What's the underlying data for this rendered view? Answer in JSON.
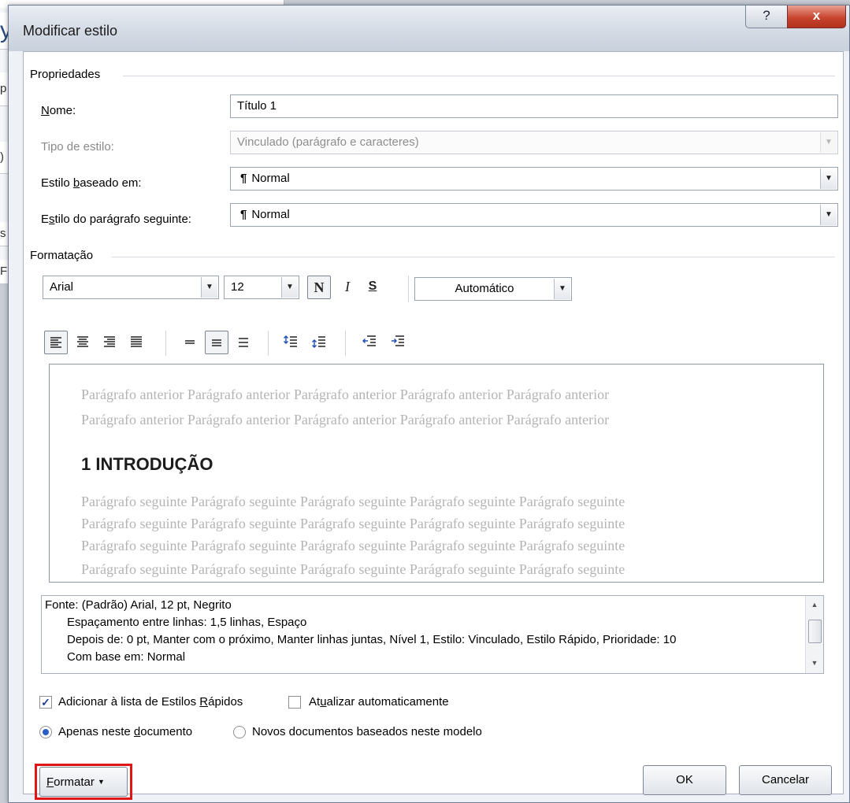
{
  "background": {
    "strip_chars": [
      "y",
      "p",
      ")",
      "s",
      "F"
    ]
  },
  "dialog": {
    "title": "Modificar estilo",
    "help_glyph": "?",
    "close_glyph": "x"
  },
  "properties": {
    "group_label": "Propriedades",
    "name_label": "Nome:",
    "name_value": "Título 1",
    "style_type_label": "Tipo de estilo:",
    "style_type_value": "Vinculado (parágrafo e caracteres)",
    "based_on_label": "Estilo baseado em:",
    "based_on_value": "Normal",
    "next_paragraph_label": "Estilo do parágrafo seguinte:",
    "next_paragraph_value": "Normal",
    "paragraph_mark": "¶"
  },
  "formatting": {
    "group_label": "Formatação",
    "font": "Arial",
    "size": "12",
    "bold_glyph": "N",
    "italic_glyph": "I",
    "underline_glyph": "S",
    "color": "Automático"
  },
  "preview": {
    "previous_line_1": "Parágrafo anterior Parágrafo anterior Parágrafo anterior Parágrafo anterior Parágrafo anterior",
    "previous_line_2": "Parágrafo anterior Parágrafo anterior Parágrafo anterior Parágrafo anterior Parágrafo anterior",
    "heading": "1 INTRODUÇÃO",
    "next_line": "Parágrafo seguinte Parágrafo seguinte Parágrafo seguinte Parágrafo seguinte Parágrafo seguinte"
  },
  "description": {
    "line_1": "Fonte: (Padrão) Arial, 12 pt, Negrito",
    "line_2": "Espaçamento entre linhas:  1,5 linhas, Espaço",
    "line_3": "Depois de:  0 pt, Manter com o próximo, Manter linhas juntas, Nível 1, Estilo: Vinculado, Estilo Rápido, Prioridade: 10",
    "line_4": "Com base em: Normal"
  },
  "options": {
    "add_quick_styles": "Adicionar à lista de Estilos Rápidos",
    "add_quick_styles_checked": true,
    "auto_update": "Atualizar automaticamente",
    "auto_update_checked": false,
    "only_this_document": "Apenas neste documento",
    "new_documents": "Novos documentos baseados neste modelo",
    "selected_scope": "only_this_document"
  },
  "buttons": {
    "format": "Formatar",
    "ok": "OK",
    "cancel": "Cancelar"
  },
  "colors": {
    "highlight_box": "#e01515",
    "close_button": "#c8452f"
  }
}
